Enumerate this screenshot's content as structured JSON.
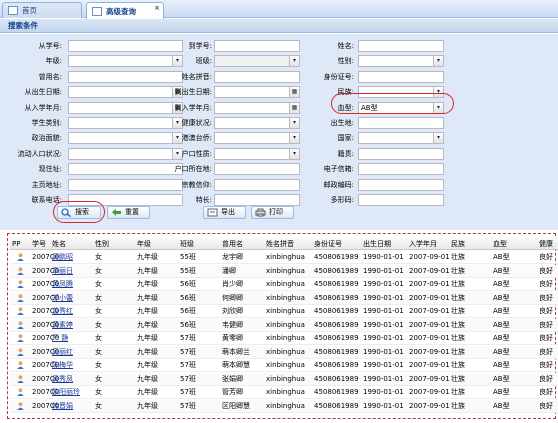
{
  "tabs": [
    {
      "label": "首页"
    },
    {
      "label": "高级查询"
    }
  ],
  "panel_title": "搜索条件",
  "form": {
    "col1": [
      {
        "label": "从学号:",
        "value": "",
        "type": "text"
      },
      {
        "label": "年级:",
        "value": "",
        "type": "select"
      },
      {
        "label": "曾用名:",
        "value": "",
        "type": "text"
      },
      {
        "label": "从出生日期:",
        "value": "",
        "type": "date"
      },
      {
        "label": "从入学年月:",
        "value": "",
        "type": "date"
      },
      {
        "label": "学生类别:",
        "value": "",
        "type": "select"
      },
      {
        "label": "政治面貌:",
        "value": "",
        "type": "select"
      },
      {
        "label": "流动人口状况:",
        "value": "",
        "type": "select"
      },
      {
        "label": "现住址:",
        "value": "",
        "type": "text"
      },
      {
        "label": "主页地址:",
        "value": "",
        "type": "text"
      },
      {
        "label": "联系电话:",
        "value": "",
        "type": "text"
      }
    ],
    "col2": [
      {
        "label": "到学号:",
        "value": "",
        "type": "text"
      },
      {
        "label": "班级:",
        "value": "",
        "type": "select-disabled"
      },
      {
        "label": "姓名拼音:",
        "value": "",
        "type": "text"
      },
      {
        "label": "到出生日期:",
        "value": "",
        "type": "date"
      },
      {
        "label": "到入学年月:",
        "value": "",
        "type": "date"
      },
      {
        "label": "健康状况:",
        "value": "",
        "type": "select"
      },
      {
        "label": "港澳台侨:",
        "value": "",
        "type": "select"
      },
      {
        "label": "户口性质:",
        "value": "",
        "type": "select"
      },
      {
        "label": "户口所在地:",
        "value": "",
        "type": "text"
      },
      {
        "label": "宗教信仰:",
        "value": "",
        "type": "text"
      },
      {
        "label": "特长:",
        "value": "",
        "type": "text"
      }
    ],
    "col3": [
      {
        "label": "姓名:",
        "value": "",
        "type": "text"
      },
      {
        "label": "性别:",
        "value": "",
        "type": "select"
      },
      {
        "label": "身份证号:",
        "value": "",
        "type": "text"
      },
      {
        "label": "民族:",
        "value": "",
        "type": "select"
      },
      {
        "label": "血型:",
        "value": "AB型",
        "type": "select"
      },
      {
        "label": "出生地:",
        "value": "",
        "type": "text"
      },
      {
        "label": "国家:",
        "value": "",
        "type": "select"
      },
      {
        "label": "籍贯:",
        "value": "",
        "type": "text"
      },
      {
        "label": "电子信箱:",
        "value": "",
        "type": "text"
      },
      {
        "label": "邮政编码:",
        "value": "",
        "type": "text"
      },
      {
        "label": "多形码:",
        "value": "",
        "type": "text"
      }
    ]
  },
  "buttons": {
    "search": "搜索",
    "reset": "重置",
    "export": "导出",
    "print": "打印"
  },
  "grid": {
    "columns": [
      "学号",
      "姓名",
      "性别",
      "年级",
      "班级",
      "曾用名",
      "姓名拼音",
      "身份证号",
      "出生日期",
      "入学年月",
      "民族",
      "血型",
      "健康"
    ],
    "header_prefix": "PP",
    "rows": [
      [
        "2007C0",
        "吴鹏昭",
        "女",
        "九年级",
        "55班",
        "龙宇卿",
        "xinbinghua",
        "4508061989",
        "1990-01-01",
        "2007-09-01",
        "壮族",
        "AB型",
        "良好"
      ],
      [
        "2007C0",
        "章丽日",
        "女",
        "九年级",
        "55班",
        "潘卿",
        "xinbinghua",
        "4508061989",
        "1990-01-01",
        "2007-09-01",
        "壮族",
        "AB型",
        "良好"
      ],
      [
        "2007C0",
        "黄凤腾",
        "女",
        "九年级",
        "56班",
        "肖少卿",
        "xinbinghua",
        "4508061989",
        "1990-01-01",
        "2007-09-01",
        "壮族",
        "AB型",
        "良好"
      ],
      [
        "2007C0",
        "郑小蕾",
        "女",
        "九年级",
        "56班",
        "何卿卿",
        "xinbinghua",
        "4508061989",
        "1990-01-01",
        "2007-09-01",
        "壮族",
        "AB型",
        "良好"
      ],
      [
        "2007C0",
        "曾秀红",
        "女",
        "九年级",
        "56班",
        "刘欣卿",
        "xinbinghua",
        "4508061989",
        "1990-01-01",
        "2007-09-01",
        "壮族",
        "AB型",
        "良好"
      ],
      [
        "2007C0",
        "黄素婷",
        "女",
        "九年级",
        "56班",
        "韦健卿",
        "xinbinghua",
        "4508061989",
        "1990-01-01",
        "2007-09-01",
        "壮族",
        "AB型",
        "良好"
      ],
      [
        "2007C0",
        "严 静",
        "女",
        "九年级",
        "57班",
        "黄零卿",
        "xinbinghua",
        "4508061989",
        "1990-01-01",
        "2007-09-01",
        "壮族",
        "AB型",
        "良好"
      ],
      [
        "2007C0",
        "吴丽红",
        "女",
        "九年级",
        "57班",
        "萌本卿兰",
        "xinbinghua",
        "4508061989",
        "1990-01-01",
        "2007-09-01",
        "壮族",
        "AB型",
        "良好"
      ],
      [
        "2007C0",
        "陈梅华",
        "女",
        "九年级",
        "57班",
        "萌本卿慧",
        "xinbinghua",
        "4508061989",
        "1990-01-01",
        "2007-09-01",
        "壮族",
        "AB型",
        "良好"
      ],
      [
        "2007C0",
        "吴秀凤",
        "女",
        "九年级",
        "57班",
        "张娟卿",
        "xinbinghua",
        "4508061989",
        "1990-01-01",
        "2007-09-01",
        "壮族",
        "AB型",
        "良好"
      ],
      [
        "2007C0",
        "欧阳丽玲",
        "女",
        "九年级",
        "57班",
        "管芳卿",
        "xinbinghua",
        "4508061989",
        "1990-01-01",
        "2007-09-01",
        "壮族",
        "AB型",
        "良好"
      ],
      [
        "2007C0",
        "韩晋娟",
        "女",
        "九年级",
        "57班",
        "区阳卿慧",
        "xinbinghua",
        "4508061989",
        "1990-01-01",
        "2007-09-01",
        "壮族",
        "AB型",
        "良好"
      ]
    ]
  },
  "colors": {
    "accent": "#15428b",
    "highlight": "#d9262c",
    "form_bg": "#dfe8f6"
  }
}
